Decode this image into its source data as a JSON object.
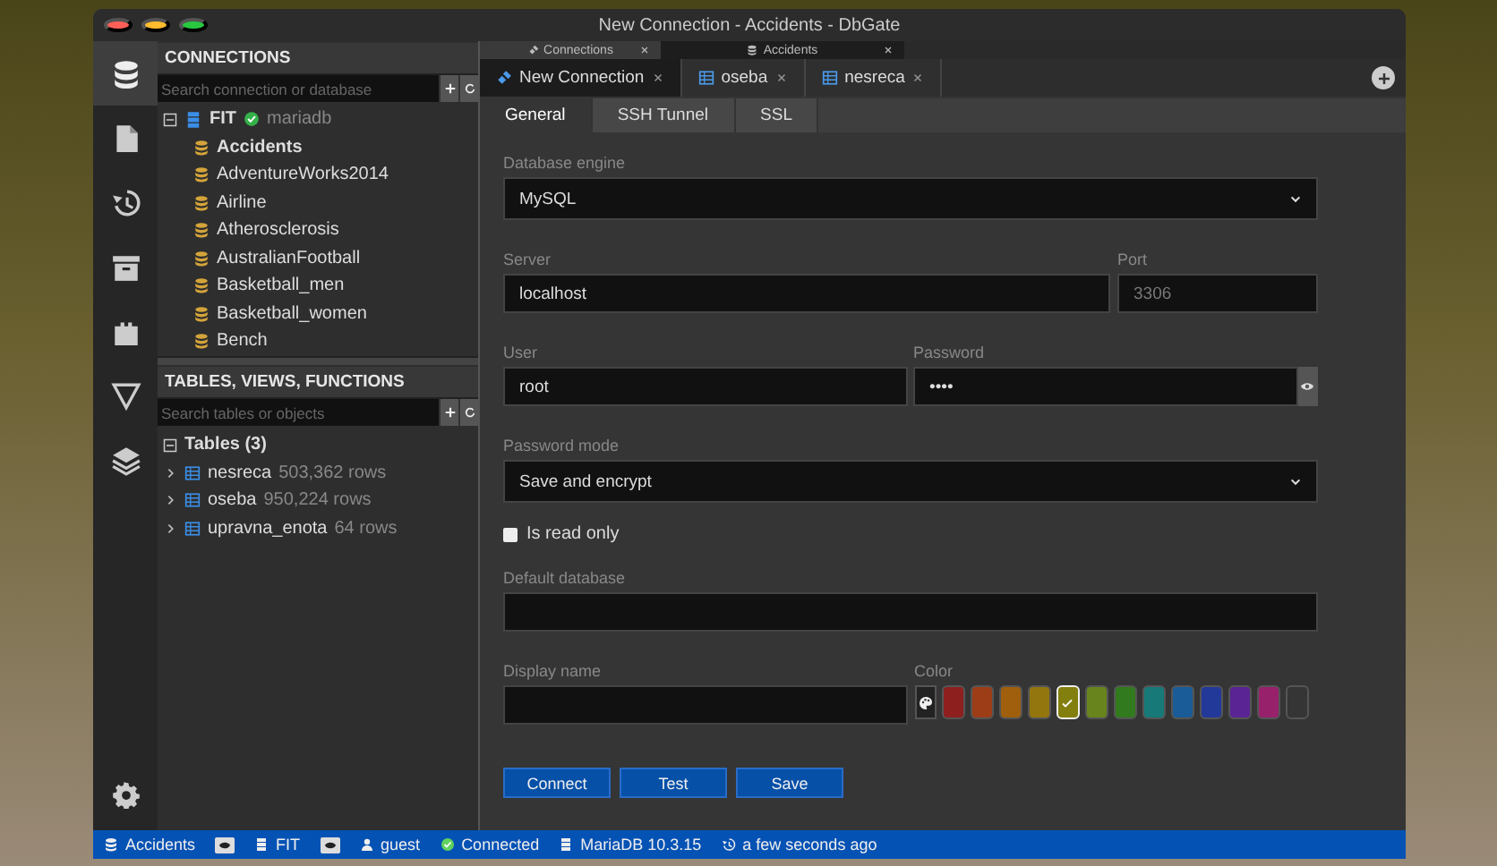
{
  "window": {
    "title": "New Connection - Accidents - DbGate"
  },
  "activity_bar": {
    "items": [
      {
        "kind": "database",
        "selected": true
      },
      {
        "kind": "file",
        "selected": false
      },
      {
        "kind": "history",
        "selected": false
      },
      {
        "kind": "archive",
        "selected": false
      },
      {
        "kind": "plugin",
        "selected": false
      },
      {
        "kind": "filter",
        "selected": false
      },
      {
        "kind": "layers",
        "selected": false
      }
    ]
  },
  "connections": {
    "header": "CONNECTIONS",
    "search_placeholder": "Search connection or database",
    "tree": [
      {
        "label": "FIT",
        "driver": "mariadb",
        "expanded": true,
        "connected": true,
        "children": [
          {
            "label": "Accidents",
            "selected": true
          },
          {
            "label": "AdventureWorks2014",
            "selected": false
          },
          {
            "label": "Airline",
            "selected": false
          },
          {
            "label": "Atherosclerosis",
            "selected": false
          },
          {
            "label": "AustralianFootball",
            "selected": false
          },
          {
            "label": "Basketball_men",
            "selected": false
          },
          {
            "label": "Basketball_women",
            "selected": false
          },
          {
            "label": "Bench",
            "selected": false
          }
        ]
      }
    ]
  },
  "objects": {
    "header": "TABLES, VIEWS, FUNCTIONS",
    "search_placeholder": "Search tables or objects",
    "groups": [
      {
        "label": "Tables (3)",
        "expanded": true,
        "children": [
          {
            "name": "nesreca",
            "rows": "503,362 rows",
            "expanded": false
          },
          {
            "name": "oseba",
            "rows": "950,224 rows",
            "expanded": false
          },
          {
            "name": "upravna_enota",
            "rows": "64 rows",
            "expanded": false
          }
        ]
      }
    ]
  },
  "tab_groups": [
    {
      "label": "Connections",
      "kind": "connection"
    },
    {
      "label": "Accidents",
      "kind": "database"
    }
  ],
  "tabs": [
    {
      "label": "New Connection",
      "kind": "connection",
      "selected": true
    },
    {
      "label": "oseba",
      "kind": "table",
      "selected": false
    },
    {
      "label": "nesreca",
      "kind": "table",
      "selected": false
    }
  ],
  "subtabs": [
    {
      "label": "General",
      "selected": true
    },
    {
      "label": "SSH Tunnel",
      "selected": false
    },
    {
      "label": "SSL",
      "selected": false
    }
  ],
  "form": {
    "database_engine": {
      "label": "Database engine",
      "value": "MySQL"
    },
    "server": {
      "label": "Server",
      "value": "localhost"
    },
    "port": {
      "label": "Port",
      "placeholder": "3306"
    },
    "user": {
      "label": "User",
      "value": "root"
    },
    "password": {
      "label": "Password",
      "value": "••••"
    },
    "password_mode": {
      "label": "Password mode",
      "value": "Save and encrypt"
    },
    "read_only": {
      "label": "Is read only",
      "checked": false
    },
    "default_database": {
      "label": "Default database"
    },
    "display_name": {
      "label": "Display name"
    },
    "color": {
      "label": "Color",
      "swatches": [
        {
          "kind": "color",
          "color": "#8e1f1f",
          "selected": false
        },
        {
          "kind": "color",
          "color": "#9c3d17",
          "selected": false
        },
        {
          "kind": "color",
          "color": "#a05f0c",
          "selected": false
        },
        {
          "kind": "color",
          "color": "#94760f",
          "selected": false
        },
        {
          "kind": "color",
          "color": "#837f0e",
          "selected": true
        },
        {
          "kind": "color",
          "color": "#68841c",
          "selected": false
        },
        {
          "kind": "color",
          "color": "#327a1e",
          "selected": false
        },
        {
          "kind": "color",
          "color": "#177a78",
          "selected": false
        },
        {
          "kind": "color",
          "color": "#1a5c98",
          "selected": false
        },
        {
          "kind": "color",
          "color": "#23399a",
          "selected": false
        },
        {
          "kind": "color",
          "color": "#5a2494",
          "selected": false
        },
        {
          "kind": "color",
          "color": "#97216b",
          "selected": false
        },
        {
          "kind": "none",
          "selected": false
        }
      ]
    }
  },
  "buttons": [
    "Connect",
    "Test",
    "Save"
  ],
  "status_bar": {
    "items": [
      {
        "kind": "database",
        "text": "Accidents"
      },
      {
        "kind": "badge"
      },
      {
        "kind": "server",
        "text": "FIT"
      },
      {
        "kind": "badge"
      },
      {
        "kind": "user",
        "text": "guest"
      },
      {
        "kind": "connected",
        "text": "Connected"
      },
      {
        "kind": "engine",
        "text": "MariaDB 10.3.15"
      },
      {
        "kind": "history",
        "text": "a few seconds ago"
      }
    ]
  }
}
